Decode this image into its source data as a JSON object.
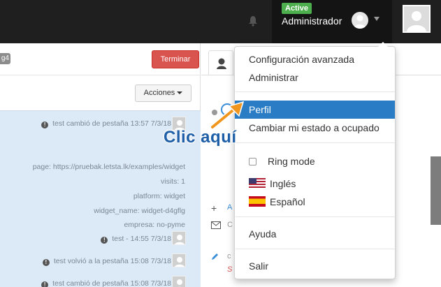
{
  "topbar": {
    "status_badge": "Active",
    "user_name": "Administrador",
    "icons": {
      "notification": "bell-icon",
      "user_caret": "caret-down-icon",
      "avatar": "user-avatar-icon"
    }
  },
  "left_panel": {
    "tag_chip": "g4",
    "terminar_label": "Terminar",
    "acciones_label": "Acciones",
    "chat_lines": [
      "test cambió de pestaña 13:57 7/3/18",
      "page: https://pruebak.letsta.lk/examples/widget",
      "visits: 1",
      "platform: widget",
      "widget_name: widget-d4gflg",
      "empresa: no-pyme",
      "test - 14:55 7/3/18",
      "test volvió a la pestaña 15:08 7/3/18",
      "test cambió de pestaña 15:08 7/3/18"
    ]
  },
  "right_panel": {
    "tab_icon": "user-icon",
    "snippets": {
      "add_letter": "A",
      "c1": "C",
      "c2": "c",
      "s": "S"
    }
  },
  "dropdown": {
    "items": {
      "advanced_config": "Configuración avanzada",
      "admin": "Administrar",
      "profile": "Perfil",
      "set_busy": "Cambiar mi estado a ocupado",
      "ring_mode": "Ring mode",
      "lang_en": "Inglés",
      "lang_es": "Español",
      "help": "Ayuda",
      "logout": "Salir"
    }
  },
  "callout": {
    "text": "Clic aquí"
  },
  "colors": {
    "accent": "#2a7dc4",
    "danger": "#d9534f",
    "success": "#4cae4c",
    "arrow": "#f0961f"
  }
}
